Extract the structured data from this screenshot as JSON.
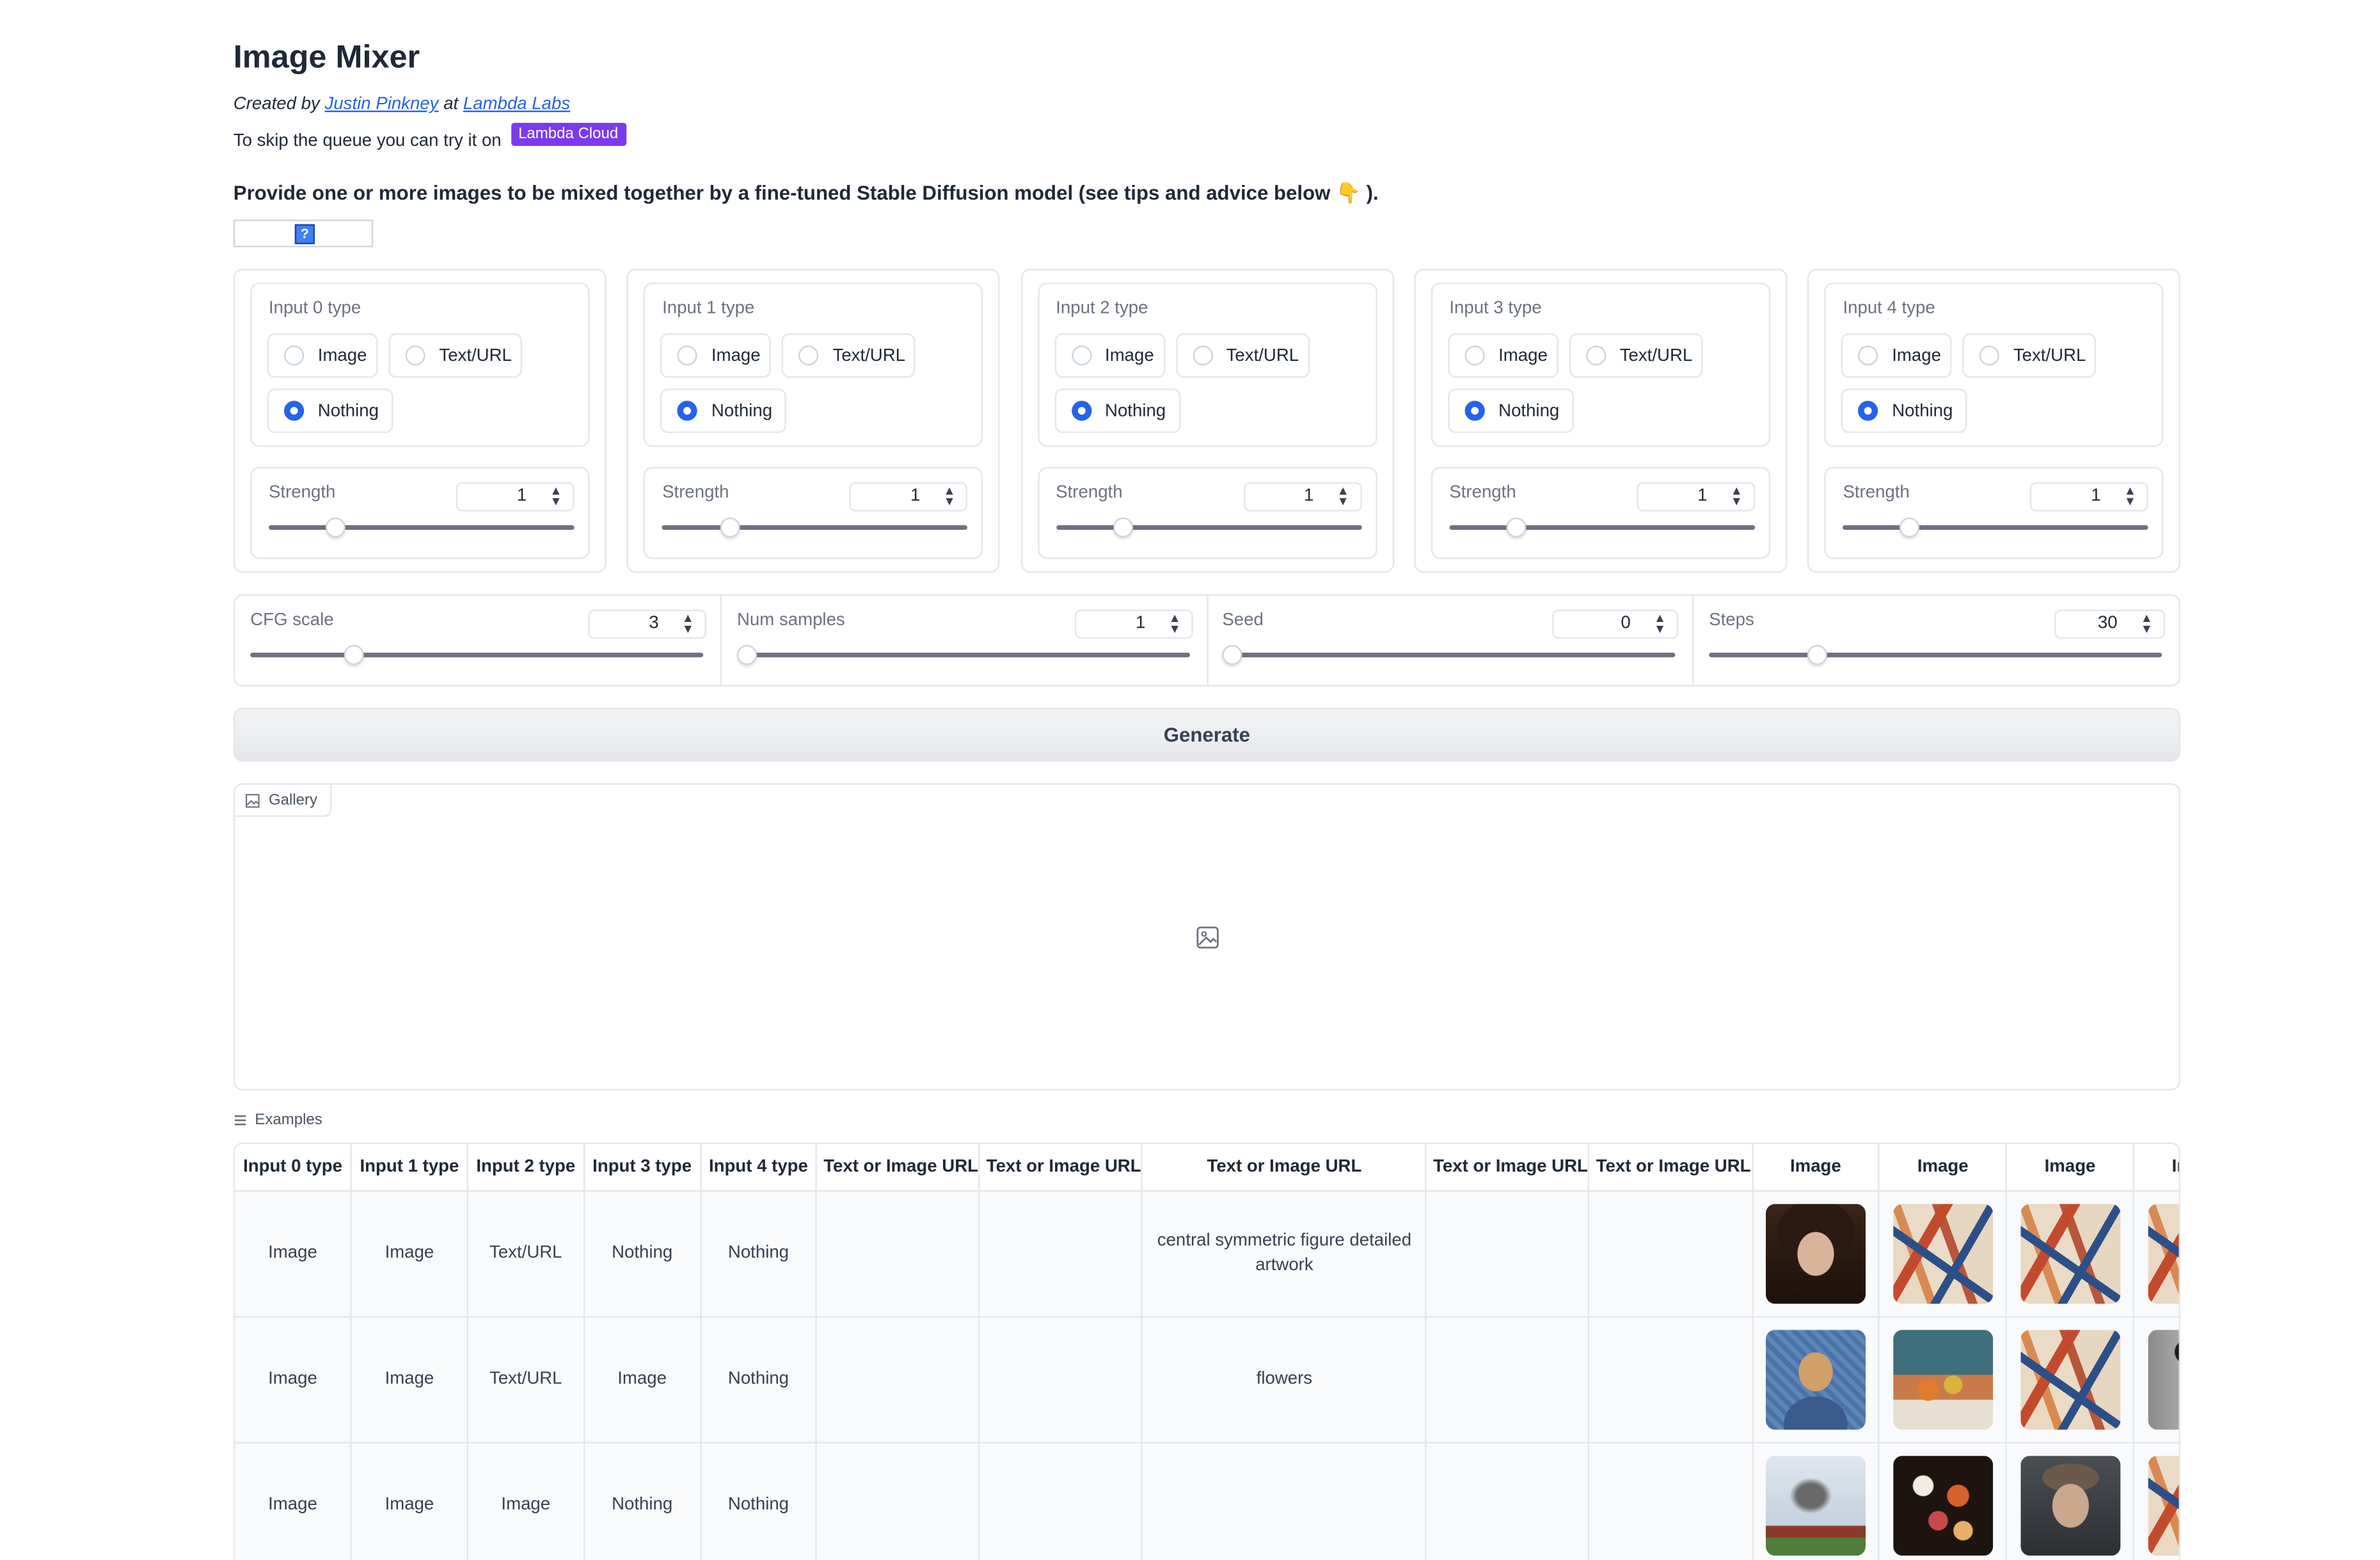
{
  "header": {
    "title": "Image Mixer",
    "created_by": "Created by",
    "author_link": "Justin Pinkney",
    "at": "at",
    "org_link": "Lambda Labs",
    "skip_text": "To skip the queue you can try it on",
    "badge": "Lambda Cloud",
    "lead": "Provide one or more images to be mixed together by a fine-tuned Stable Diffusion model (see tips and advice below 👇 ).",
    "duplicate_icon": "?"
  },
  "inputs": [
    {
      "type_label": "Input 0 type",
      "options": [
        "Image",
        "Text/URL",
        "Nothing"
      ],
      "selected": "Nothing",
      "strength_label": "Strength",
      "strength": "1",
      "strength_fraction": 0.22
    },
    {
      "type_label": "Input 1 type",
      "options": [
        "Image",
        "Text/URL",
        "Nothing"
      ],
      "selected": "Nothing",
      "strength_label": "Strength",
      "strength": "1",
      "strength_fraction": 0.22
    },
    {
      "type_label": "Input 2 type",
      "options": [
        "Image",
        "Text/URL",
        "Nothing"
      ],
      "selected": "Nothing",
      "strength_label": "Strength",
      "strength": "1",
      "strength_fraction": 0.22
    },
    {
      "type_label": "Input 3 type",
      "options": [
        "Image",
        "Text/URL",
        "Nothing"
      ],
      "selected": "Nothing",
      "strength_label": "Strength",
      "strength": "1",
      "strength_fraction": 0.22
    },
    {
      "type_label": "Input 4 type",
      "options": [
        "Image",
        "Text/URL",
        "Nothing"
      ],
      "selected": "Nothing",
      "strength_label": "Strength",
      "strength": "1",
      "strength_fraction": 0.22
    }
  ],
  "params": [
    {
      "label": "CFG scale",
      "value": "3",
      "fraction": 0.23
    },
    {
      "label": "Num samples",
      "value": "1",
      "fraction": 0.0
    },
    {
      "label": "Seed",
      "value": "0",
      "fraction": 0.0
    },
    {
      "label": "Steps",
      "value": "30",
      "fraction": 0.24
    }
  ],
  "generate_label": "Generate",
  "gallery_label": "Gallery",
  "examples": {
    "label": "Examples",
    "headers": [
      "Input 0 type",
      "Input 1 type",
      "Input 2 type",
      "Input 3 type",
      "Input 4 type",
      "Text or Image URL",
      "Text or Image URL",
      "Text or Image URL",
      "Text or Image URL",
      "Text or Image URL",
      "Image",
      "Image",
      "Image",
      "Image"
    ],
    "rows": [
      {
        "cells": [
          "Image",
          "Image",
          "Text/URL",
          "Nothing",
          "Nothing",
          "",
          "",
          "central symmetric figure detailed artwork",
          "",
          ""
        ],
        "thumbs": [
          "portrait-woman",
          "cubist-abstract",
          "cubist-abstract",
          "cubist-abstract"
        ]
      },
      {
        "cells": [
          "Image",
          "Image",
          "Text/URL",
          "Image",
          "Nothing",
          "",
          "",
          "flowers",
          "",
          ""
        ],
        "thumbs": [
          "van-gogh-self-portrait",
          "still-life-fruit",
          "cubist-abstract",
          "bw-portrait"
        ]
      },
      {
        "cells": [
          "Image",
          "Image",
          "Image",
          "Nothing",
          "Nothing",
          "",
          "",
          "",
          "",
          ""
        ],
        "thumbs": [
          "tree-house-landscape",
          "flower-bouquet",
          "man-portrait",
          "cubist-abstract"
        ]
      }
    ]
  }
}
